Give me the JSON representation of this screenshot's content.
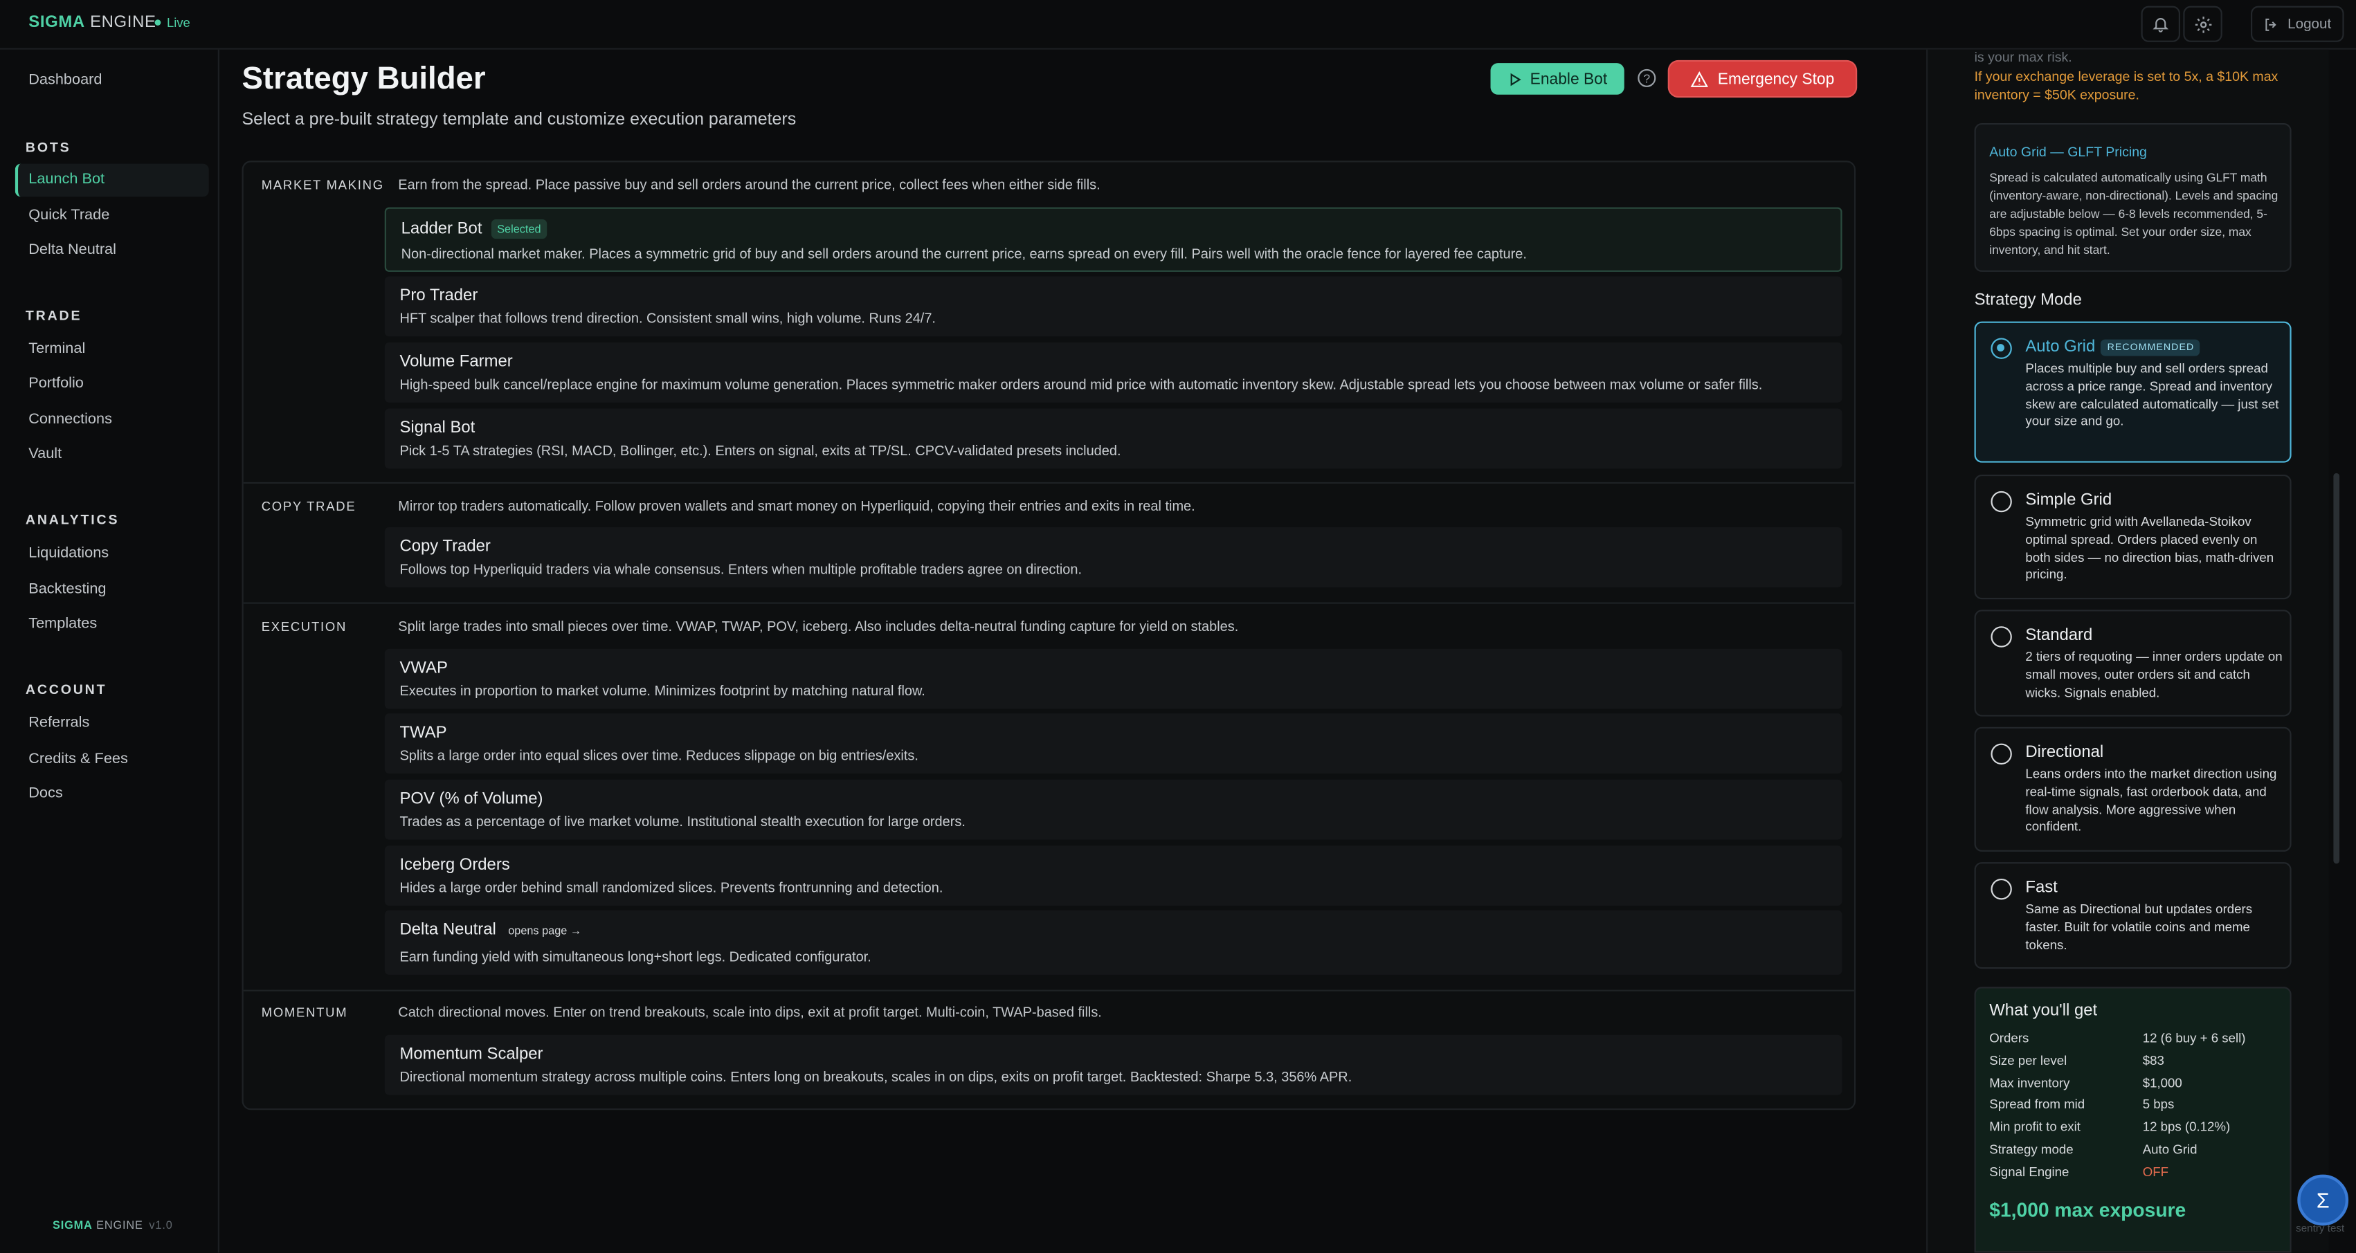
{
  "topbar": {
    "brand_sigma": "SIGMA",
    "brand_engine": "ENGINE",
    "status": "Live",
    "logout": "Logout"
  },
  "sidebar": {
    "dashboard": "Dashboard",
    "groups": {
      "bots": {
        "title": "BOTS",
        "items": [
          "Launch Bot",
          "Quick Trade",
          "Delta Neutral"
        ]
      },
      "trade": {
        "title": "TRADE",
        "items": [
          "Terminal",
          "Portfolio",
          "Connections",
          "Vault"
        ]
      },
      "analytics": {
        "title": "ANALYTICS",
        "items": [
          "Liquidations",
          "Backtesting",
          "Templates"
        ]
      },
      "account": {
        "title": "ACCOUNT",
        "items": [
          "Referrals",
          "Credits & Fees",
          "Docs"
        ]
      }
    },
    "active_item": "Launch Bot",
    "footer": {
      "sigma": "SIGMA",
      "engine": "ENGINE",
      "version": "v1.0"
    }
  },
  "header": {
    "title": "Strategy Builder",
    "subtitle": "Select a pre-built strategy template and customize execution parameters",
    "enable_bot": "Enable Bot",
    "help": "?",
    "emergency_stop": "Emergency Stop"
  },
  "sections": {
    "market_making": {
      "label": "MARKET MAKING",
      "description": "Earn from the spread. Place passive buy and sell orders around the current price, collect fees when either side fills.",
      "cards": [
        {
          "title": "Ladder Bot",
          "badge": "Selected",
          "description": "Non-directional market maker. Places a symmetric grid of buy and sell orders around the current price, earns spread on every fill. Pairs well with the oracle fence for layered fee capture."
        },
        {
          "title": "Pro Trader",
          "description": "HFT scalper that follows trend direction. Consistent small wins, high volume. Runs 24/7."
        },
        {
          "title": "Volume Farmer",
          "description": "High-speed bulk cancel/replace engine for maximum volume generation. Places symmetric maker orders around mid price with automatic inventory skew. Adjustable spread lets you choose between max volume or safer fills."
        },
        {
          "title": "Signal Bot",
          "description": "Pick 1-5 TA strategies (RSI, MACD, Bollinger, etc.). Enters on signal, exits at TP/SL. CPCV-validated presets included."
        }
      ]
    },
    "copy_trade": {
      "label": "COPY TRADE",
      "description": "Mirror top traders automatically. Follow proven wallets and smart money on Hyperliquid, copying their entries and exits in real time.",
      "cards": [
        {
          "title": "Copy Trader",
          "description": "Follows top Hyperliquid traders via whale consensus. Enters when multiple profitable traders agree on direction."
        }
      ]
    },
    "execution": {
      "label": "EXECUTION",
      "description": "Split large trades into small pieces over time. VWAP, TWAP, POV, iceberg. Also includes delta-neutral funding capture for yield on stables.",
      "cards": [
        {
          "title": "VWAP",
          "description": "Executes in proportion to market volume. Minimizes footprint by matching natural flow."
        },
        {
          "title": "TWAP",
          "description": "Splits a large order into equal slices over time. Reduces slippage on big entries/exits."
        },
        {
          "title": "POV (% of Volume)",
          "description": "Trades as a percentage of live market volume. Institutional stealth execution for large orders."
        },
        {
          "title": "Iceberg Orders",
          "description": "Hides a large order behind small randomized slices. Prevents frontrunning and detection."
        },
        {
          "title": "Delta Neutral",
          "badge": "opens page →",
          "description": "Earn funding yield with simultaneous long+short legs. Dedicated configurator."
        }
      ]
    },
    "momentum": {
      "label": "MOMENTUM",
      "description": "Catch directional moves. Enter on trend breakouts, scale into dips, exit at profit target. Multi-coin, TWAP-based fills.",
      "cards": [
        {
          "title": "Momentum Scalper",
          "description": "Directional momentum strategy across multiple coins. Enters long on breakouts, scales in on dips, exits on profit target. Backtested: Sharpe 5.3, 356% APR."
        }
      ]
    }
  },
  "right_panel": {
    "warning_top": "is your max risk.",
    "warning": "If your exchange leverage is set to 5x, a $10K max inventory = $50K exposure.",
    "glft": {
      "title": "Auto Grid — GLFT Pricing",
      "body": "Spread is calculated automatically using GLFT math (inventory-aware, non-directional). Levels and spacing are adjustable below — 6-8 levels recommended, 5-6bps spacing is optimal. Set your order size, max inventory, and hit start."
    },
    "strategy_mode_title": "Strategy Mode",
    "modes": [
      {
        "name": "Auto Grid",
        "badge": "RECOMMENDED",
        "description": "Places multiple buy and sell orders spread across a price range. Spread and inventory skew are calculated automatically — just set your size and go."
      },
      {
        "name": "Simple Grid",
        "description": "Symmetric grid with Avellaneda-Stoikov optimal spread. Orders placed evenly on both sides — no direction bias, math-driven pricing."
      },
      {
        "name": "Standard",
        "description": "2 tiers of requoting — inner orders update on small moves, outer orders sit and catch wicks. Signals enabled."
      },
      {
        "name": "Directional",
        "description": "Leans orders into the market direction using real-time signals, fast orderbook data, and flow analysis. More aggressive when confident."
      },
      {
        "name": "Fast",
        "description": "Same as Directional but updates orders faster. Built for volatile coins and meme tokens."
      }
    ],
    "selected_mode": "Auto Grid",
    "what_youll_get": {
      "title": "What you'll get",
      "rows": [
        {
          "label": "Orders",
          "value": "12 (6 buy + 6 sell)"
        },
        {
          "label": "Size per level",
          "value": "$83"
        },
        {
          "label": "Max inventory",
          "value": "$1,000"
        },
        {
          "label": "Spread from mid",
          "value": "5 bps"
        },
        {
          "label": "Min profit to exit",
          "value": "12 bps (0.12%)"
        },
        {
          "label": "Strategy mode",
          "value": "Auto Grid"
        },
        {
          "label": "Signal Engine",
          "value": "OFF"
        }
      ],
      "exposure": "$1,000 max exposure"
    }
  },
  "fab": {
    "symbol": "Σ",
    "caption": "sentry test"
  },
  "colors": {
    "accent": "#4fd1a5",
    "danger": "#d63a3a",
    "info": "#4fb6d9",
    "warning": "#e39b3a"
  }
}
